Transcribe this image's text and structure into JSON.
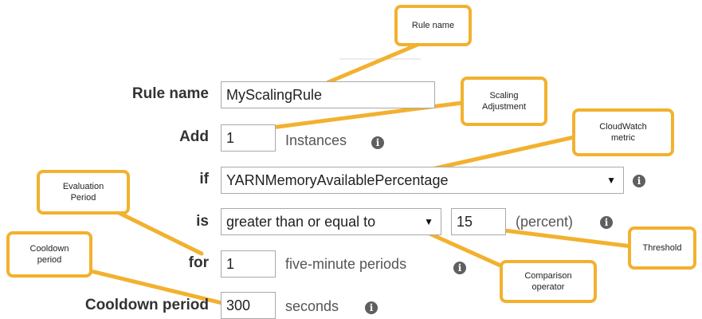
{
  "form": {
    "rule_name": {
      "label": "Rule name",
      "value": "MyScalingRule"
    },
    "add": {
      "label": "Add",
      "value": "1",
      "suffix": "Instances"
    },
    "if": {
      "label": "if",
      "selected": "YARNMemoryAvailablePercentage"
    },
    "is": {
      "label": "is",
      "operator": "greater than or equal to",
      "threshold": "15",
      "suffix": "(percent)"
    },
    "for": {
      "label": "for",
      "value": "1",
      "suffix": "five-minute periods"
    },
    "cooldown": {
      "label": "Cooldown period",
      "value": "300",
      "suffix": "seconds"
    }
  },
  "callouts": {
    "rule_name": "Rule name",
    "scaling_adjustment": "Scaling\nAdjustment",
    "cloudwatch_metric": "CloudWatch\nmetric",
    "evaluation_period": "Evaluation\nPeriod",
    "cooldown_period": "Cooldown\nperiod",
    "threshold": "Threshold",
    "comparison_operator": "Comparison\noperator"
  },
  "icons": {
    "info": "info-icon",
    "dropdown": "dropdown-arrow-icon"
  },
  "colors": {
    "callout_border": "#f2b12e",
    "label_text": "#333333",
    "info_icon": "#5f5f5f"
  }
}
